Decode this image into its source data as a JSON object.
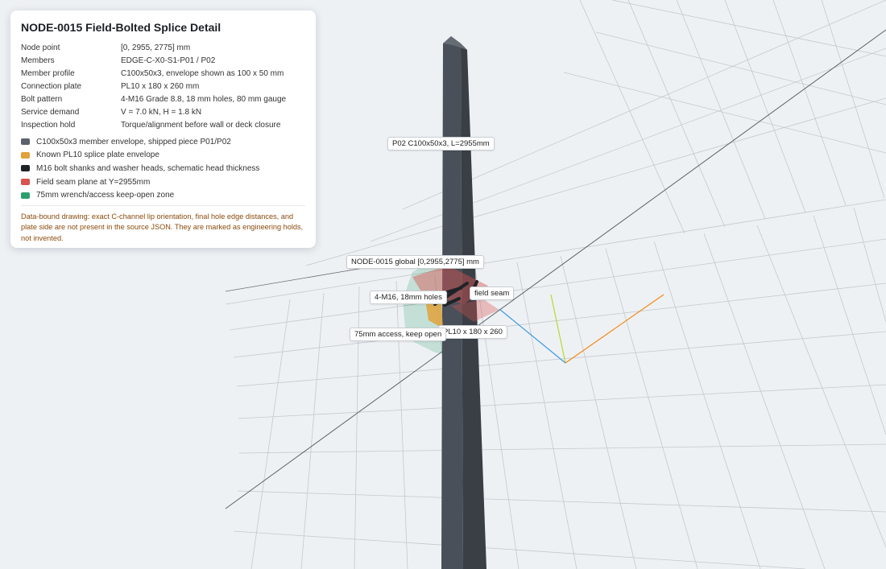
{
  "panel": {
    "title": "NODE-0015 Field-Bolted Splice Detail",
    "specs": [
      {
        "key": "Node point",
        "value": "[0, 2955, 2775] mm"
      },
      {
        "key": "Members",
        "value": "EDGE-C-X0-S1-P01 / P02"
      },
      {
        "key": "Member profile",
        "value": "C100x50x3, envelope shown as 100 x 50 mm"
      },
      {
        "key": "Connection plate",
        "value": "PL10 x 180 x 260 mm"
      },
      {
        "key": "Bolt pattern",
        "value": "4-M16 Grade 8.8, 18 mm holes, 80 mm gauge"
      },
      {
        "key": "Service demand",
        "value": "V = 7.0 kN, H = 1.8 kN"
      },
      {
        "key": "Inspection hold",
        "value": "Torque/alignment before wall or deck closure"
      }
    ],
    "legend": [
      {
        "color": "#5b626b",
        "label": "C100x50x3 member envelope, shipped piece P01/P02"
      },
      {
        "color": "#e0a23b",
        "label": "Known PL10 splice plate envelope"
      },
      {
        "color": "#1f2328",
        "label": "M16 bolt shanks and washer heads, schematic head thickness"
      },
      {
        "color": "#d9534f",
        "label": "Field seam plane at Y=2955mm"
      },
      {
        "color": "#2e9e6e",
        "label": "75mm wrench/access keep-open zone"
      }
    ],
    "note": "Data-bound drawing: exact C-channel lip orientation, final hole edge distances, and plate side are not present in the source JSON. They are marked as engineering holds, not invented."
  },
  "callouts": {
    "member": "P02 C100x50x3, L=2955mm",
    "node": "NODE-0015 global [0,2955,2775] mm",
    "seam": "field seam",
    "bolts": "4-M16, 18mm holes",
    "plate": "PL10 x 180 x 260",
    "access": "75mm access, keep open"
  },
  "colors": {
    "background": "#eef1f4",
    "grid": "#c3c8ce",
    "member": "#4a5059",
    "plate": "#e0a23b",
    "bolt": "#1f2328",
    "seam": "#d9534f",
    "access": "#2e9e6e",
    "note_text": "#8a4b0d"
  }
}
